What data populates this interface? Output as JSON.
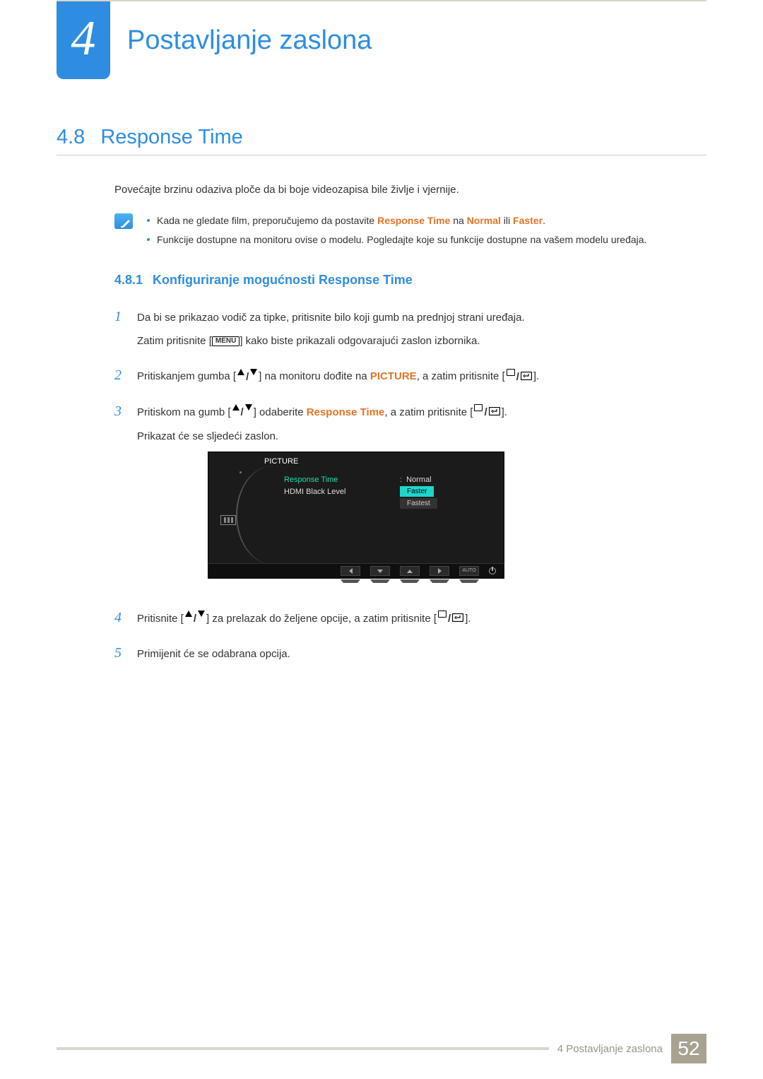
{
  "chapter": {
    "number": "4",
    "title": "Postavljanje zaslona"
  },
  "section": {
    "number": "4.8",
    "title": "Response Time"
  },
  "intro": "Povećajte brzinu odaziva ploče da bi boje videozapisa bile življe i vjernije.",
  "note": {
    "bullet1_a": "Kada ne gledate film, preporučujemo da postavite ",
    "bullet1_rt": "Response Time",
    "bullet1_b": " na ",
    "bullet1_normal": "Normal",
    "bullet1_c": " ili ",
    "bullet1_faster": "Faster",
    "bullet1_d": ".",
    "bullet2": "Funkcije dostupne na monitoru ovise o modelu. Pogledajte koje su funkcije dostupne na vašem modelu uređaja."
  },
  "subsection": {
    "number": "4.8.1",
    "title": "Konfiguriranje mogućnosti Response Time"
  },
  "steps": {
    "s1": {
      "p1": "Da bi se prikazao vodič za tipke, pritisnite bilo koji gumb na prednjoj strani uređaja.",
      "p2a": "Zatim pritisnite [",
      "menu": "MENU",
      "p2b": "] kako biste prikazali odgovarajući zaslon izbornika."
    },
    "s2": {
      "a": "Pritiskanjem gumba [",
      "b": "] na monitoru dođite na ",
      "picture": "PICTURE",
      "c": ", a zatim pritisnite [",
      "d": "]."
    },
    "s3": {
      "a": "Pritiskom na gumb [",
      "b": "] odaberite ",
      "rt": "Response Time",
      "c": ", a zatim pritisnite [",
      "d": "].",
      "p2": "Prikazat će se sljedeći zaslon."
    },
    "s4": {
      "a": "Pritisnite [",
      "b": "] za prelazak do željene opcije, a zatim pritisnite [",
      "c": "]."
    },
    "s5": "Primijenit će se odabrana opcija."
  },
  "osd": {
    "title": "PICTURE",
    "item1": "Response Time",
    "item2": "HDMI Black Level",
    "opt1": "Normal",
    "opt2": "Faster",
    "opt3": "Fastest",
    "auto": "AUTO"
  },
  "footer": {
    "label": "4 Postavljanje zaslona",
    "page": "52"
  }
}
